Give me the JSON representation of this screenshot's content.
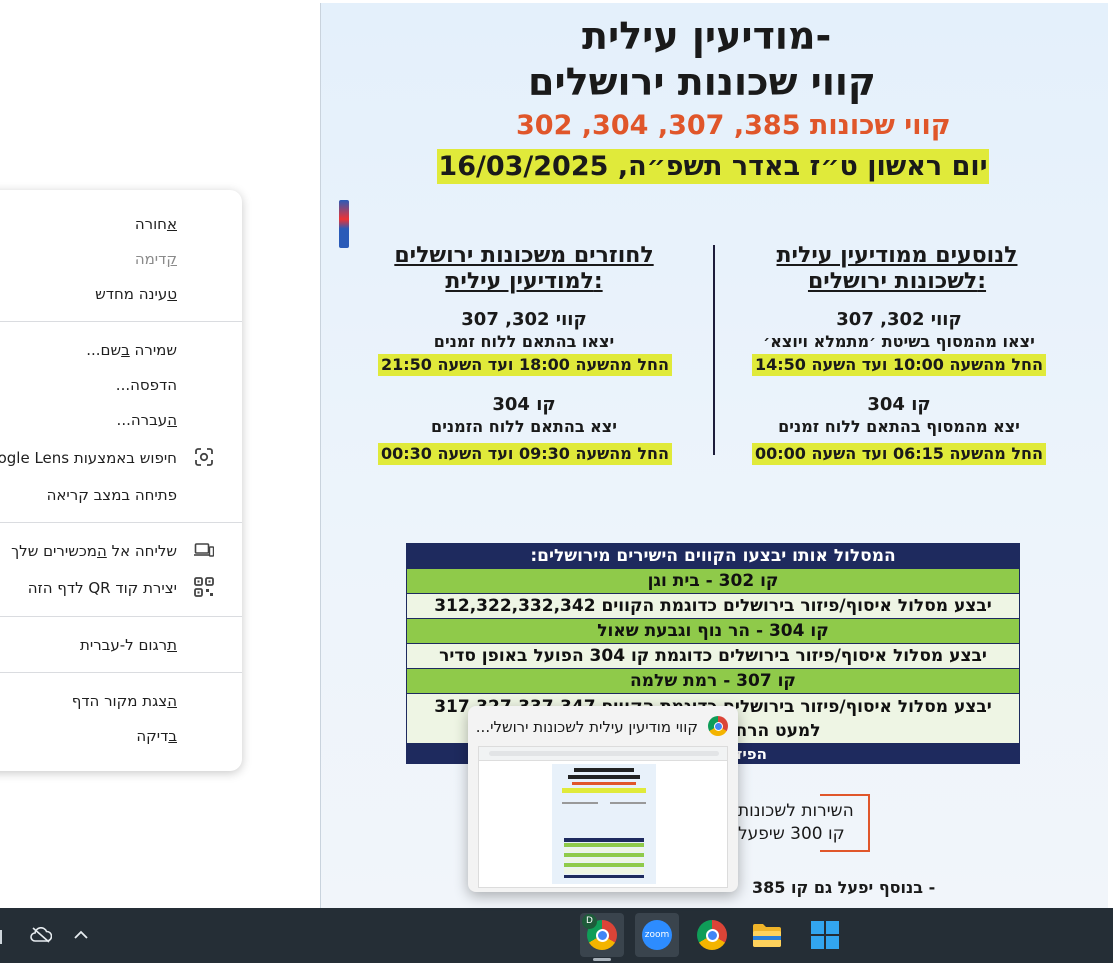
{
  "poster": {
    "title_line1": "מודיעין עילית-",
    "title_line2": "קווי שכונות ירושלים",
    "subtitle": "קווי שכונות 385, 307, 304, 302",
    "date_line": "יום ראשון ט״ז באדר תשפ״ה, 16/03/2025",
    "right_col": {
      "heading1": "לנוסעים ממודיעין עילית",
      "heading2": "לשכונות ירושלים:",
      "lines_a_title": "קווי 302, 307",
      "lines_a_desc": "יצאו מהמסוף בשיטת ׳מתמלא ויוצא׳",
      "lines_a_hours": "החל מהשעה 10:00 ועד השעה 14:50",
      "line_b_title": "קו 304",
      "line_b_desc": "יצא מהמסוף בהתאם ללוח זמנים",
      "line_b_hours": "החל מהשעה 06:15 ועד השעה 00:00"
    },
    "left_col": {
      "heading1": "לחוזרים משכונות ירושלים",
      "heading2": "למודיעין עילית:",
      "lines_a_title": "קווי 302, 307",
      "lines_a_desc": "יצאו בהתאם ללוח זמנים",
      "lines_a_hours": "החל מהשעה 18:00 ועד השעה 21:50",
      "line_b_title": "קו 304",
      "line_b_desc": "יצא בהתאם ללוח הזמנים",
      "line_b_hours": "החל מהשעה 09:30 ועד השעה 00:30"
    },
    "table": {
      "header": "המסלול אותו יבצעו הקווים הישירים מירושלים:",
      "row1": "קו 302 - בית וגן",
      "row2": "יבצע מסלול איסוף/פיזור בירושלים כדוגמת הקווים 312,322,332,342",
      "row3": "קו 304 - הר נוף וגבעת שאול",
      "row4": "יבצע מסלול איסוף/פיזור בירושלים כדוגמת קו 304 הפועל באופן סדיר",
      "row5": "קו 307 - רמת שלמה",
      "row6a": "יבצע מסלול איסוף/פיזור בירושלים כדוגמת הקווים 317,327,337,347",
      "row6b": "למעט הרחובות אגרות משה",
      "row7": "הפיזור במודיעין"
    },
    "box_line1": "השירות לשכונות",
    "box_line2": "קו 300 שיפעל",
    "bottom_line": "בנוסף יפעל גם קו 385 -"
  },
  "menu": {
    "back": "חורה",
    "back_u": "א",
    "forward": "דימה",
    "forward_u": "ק",
    "reload": "עינה מחדש",
    "reload_u": "ט",
    "save_pre": "שמירה ",
    "save_u": "ב",
    "save_post": "שם...",
    "print": "הדפסה...",
    "cast_pre": "",
    "cast_u": "ה",
    "cast_post": "עברה...",
    "lens": "חיפוש באמצעות Google Lens",
    "reading_mode": "פתיחה במצב קריאה",
    "send_pre": "שליחה אל ",
    "send_u": "ה",
    "send_post": "מכשירים שלך",
    "qr": "יצירת קוד QR לדף הזה",
    "translate_u": "ת",
    "translate_post": "רגום ל-עברית",
    "source_u": "ה",
    "source_post": "צגת מקור הדף",
    "inspect_u": "ב",
    "inspect_post": "דיקה"
  },
  "thumbnail": {
    "title": "קווי מודיעין עילית לשכונות ירושלי..."
  },
  "taskbar": {
    "chrome_badge": "D",
    "zoom_label": "zoom"
  },
  "colors": {
    "highlight_yellow": "#e0ea3a",
    "subtitle_orange": "#e0562a",
    "table_navy": "#1e2a5e",
    "table_green": "#8fca4a",
    "taskbar": "#252e36"
  }
}
